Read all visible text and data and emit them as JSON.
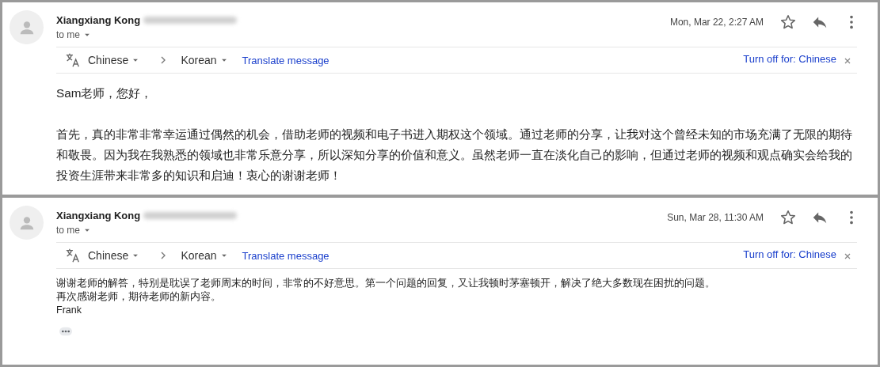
{
  "messages": [
    {
      "sender": "Xiangxiang Kong",
      "email_blurred": true,
      "recipient": "to me",
      "date": "Mon, Mar 22, 2:27 AM",
      "starred": false,
      "kind": "large",
      "translate": {
        "from": "Chinese",
        "to": "Korean",
        "action": "Translate message",
        "turn_off": "Turn off for: Chinese"
      },
      "body": [
        "Sam老师，您好，",
        "首先，真的非常非常幸运通过偶然的机会，借助老师的视频和电子书进入期权这个领域。通过老师的分享，让我对这个曾经未知的市场充满了无限的期待和敬畏。因为我在我熟悉的领域也非常乐意分享，所以深知分享的价值和意义。虽然老师一直在淡化自己的影响，但通过老师的视频和观点确实会给我的投资生涯带来非常多的知识和启迪！衷心的谢谢老师！"
      ],
      "trimmed": false
    },
    {
      "sender": "Xiangxiang Kong",
      "email_blurred": true,
      "recipient": "to me",
      "date": "Sun, Mar 28, 11:30 AM",
      "starred": false,
      "kind": "small",
      "translate": {
        "from": "Chinese",
        "to": "Korean",
        "action": "Translate message",
        "turn_off": "Turn off for: Chinese"
      },
      "body": [
        "谢谢老师的解答，特别是耽误了老师周末的时间，非常的不好意思。第一个问题的回复，又让我顿时茅塞顿开，解决了绝大多数现在困扰的问题。",
        "再次感谢老师，期待老师的新内容。",
        "Frank"
      ],
      "trimmed": true
    }
  ]
}
